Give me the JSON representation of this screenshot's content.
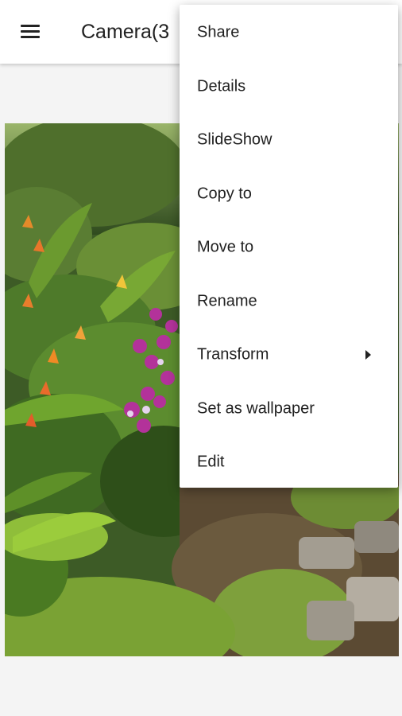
{
  "appbar": {
    "title": "Camera(3",
    "menu_icon": "hamburger-menu-icon"
  },
  "viewer": {
    "image": "photo of tropical garden with orchids, heliconia and stone steps"
  },
  "overflow_menu": {
    "items": [
      {
        "label": "Share"
      },
      {
        "label": "Details"
      },
      {
        "label": "SlideShow"
      },
      {
        "label": "Copy to"
      },
      {
        "label": "Move to"
      },
      {
        "label": "Rename"
      },
      {
        "label": "Transform",
        "submenu_icon": "submenu-arrow-icon"
      },
      {
        "label": "Set as wallpaper"
      },
      {
        "label": "Edit"
      }
    ]
  }
}
